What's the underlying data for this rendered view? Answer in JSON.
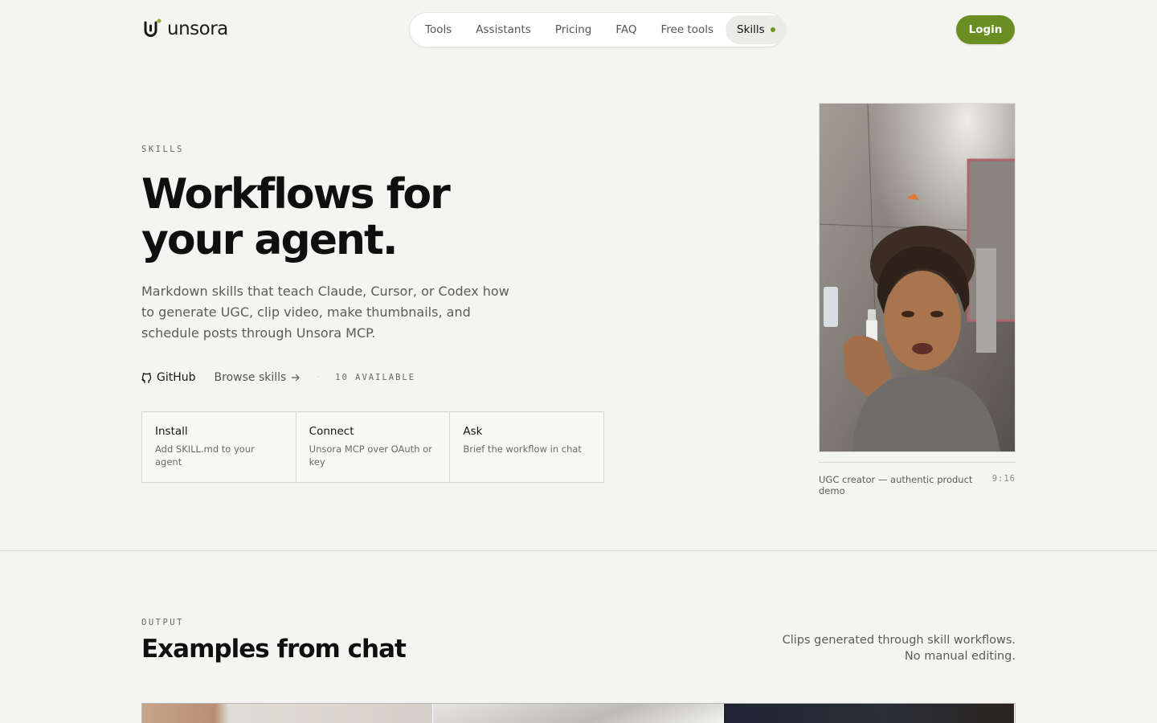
{
  "brand": {
    "name": "unsora",
    "accent": "#6b8e23",
    "dot_color": "#6f9a1f"
  },
  "nav": {
    "items": [
      {
        "label": "Tools"
      },
      {
        "label": "Assistants"
      },
      {
        "label": "Pricing"
      },
      {
        "label": "FAQ"
      },
      {
        "label": "Free tools"
      },
      {
        "label": "Skills",
        "active": true
      }
    ],
    "login_label": "Login"
  },
  "hero": {
    "eyebrow": "SKILLS",
    "title": "Workflows for your agent.",
    "description": "Markdown skills that teach Claude, Cursor, or Codex how to generate UGC, clip video, make thumbnails, and schedule posts through Unsora MCP.",
    "github_label": "GitHub",
    "browse_label": "Browse skills",
    "separator": "·",
    "available_label": "10 AVAILABLE",
    "steps": [
      {
        "title": "Install",
        "desc": "Add SKILL.md to your agent"
      },
      {
        "title": "Connect",
        "desc": "Unsora MCP over OAuth or key"
      },
      {
        "title": "Ask",
        "desc": "Brief the workflow in chat"
      }
    ],
    "video_caption": "UGC creator — authentic product demo",
    "video_ratio": "9:16"
  },
  "output": {
    "eyebrow": "OUTPUT",
    "title": "Examples from chat",
    "note": "Clips generated through skill workflows. No manual editing."
  }
}
